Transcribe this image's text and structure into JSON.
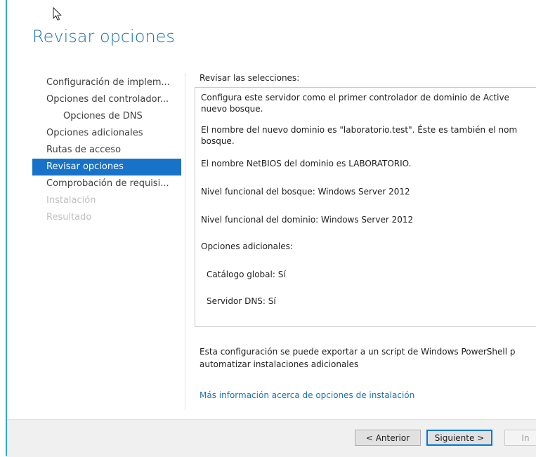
{
  "page": {
    "title": "Revisar opciones"
  },
  "sidebar": {
    "items": [
      {
        "label": "Configuración de implem...",
        "state": "normal"
      },
      {
        "label": "Opciones del controlador...",
        "state": "normal"
      },
      {
        "label": "Opciones de DNS",
        "state": "sub"
      },
      {
        "label": "Opciones adicionales",
        "state": "normal"
      },
      {
        "label": "Rutas de acceso",
        "state": "normal"
      },
      {
        "label": "Revisar opciones",
        "state": "active"
      },
      {
        "label": "Comprobación de requisi...",
        "state": "normal"
      },
      {
        "label": "Instalación",
        "state": "disabled"
      },
      {
        "label": "Resultado",
        "state": "disabled"
      }
    ]
  },
  "review": {
    "label": "Revisar las selecciones:",
    "lines": [
      "Configura este servidor como el primer controlador de dominio de Active",
      "nuevo bosque.",
      "El nombre del nuevo dominio es \"laboratorio.test\". Éste es también el nom",
      "bosque.",
      "El nombre NetBIOS del dominio es LABORATORIO.",
      "Nivel funcional del bosque: Windows Server 2012",
      "Nivel funcional del dominio: Windows Server 2012",
      "Opciones adicionales:",
      "Catálogo global: Sí",
      "Servidor DNS: Sí"
    ]
  },
  "footer": {
    "note_line1": "Esta configuración se puede exportar a un script de Windows PowerShell p",
    "note_line2": "automatizar instalaciones adicionales",
    "more_link": "Más información acerca de opciones de instalación"
  },
  "buttons": {
    "previous": "< Anterior",
    "next": "Siguiente >",
    "install": "In"
  },
  "colors": {
    "accent": "#1673c9",
    "title": "#1b72b4",
    "left_border": "#31a8d8"
  }
}
